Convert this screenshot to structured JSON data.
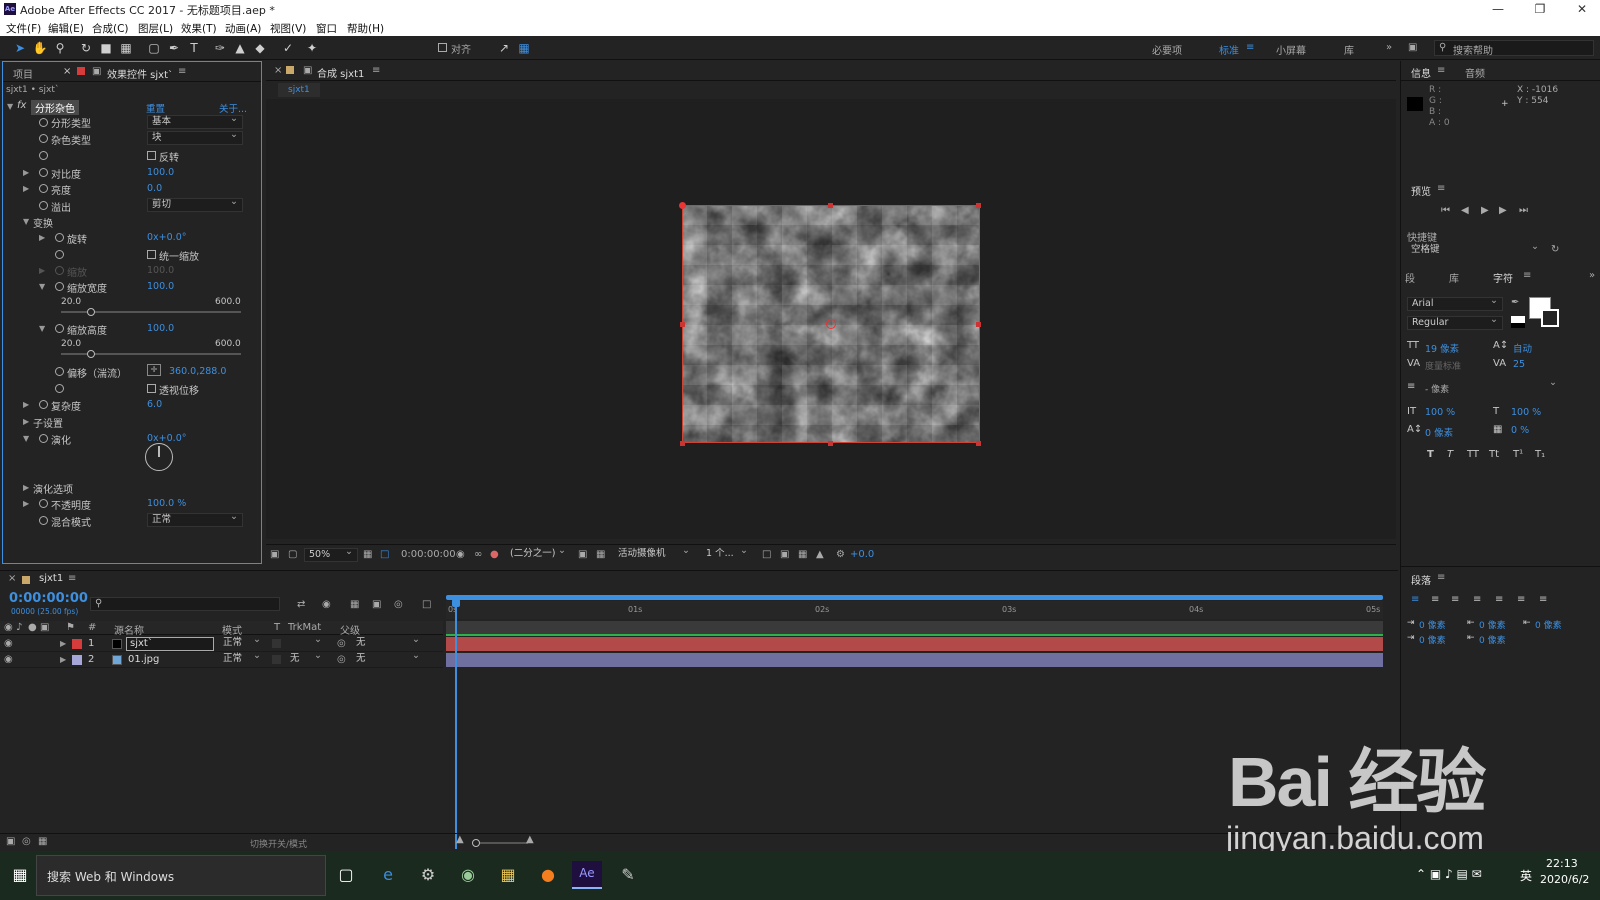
{
  "app": {
    "title": "Adobe After Effects CC 2017 - 无标题项目.aep *",
    "logo": "Ae"
  },
  "menu": [
    "文件(F)",
    "编辑(E)",
    "合成(C)",
    "图层(L)",
    "效果(T)",
    "动画(A)",
    "视图(V)",
    "窗口",
    "帮助(H)"
  ],
  "toolbar": {
    "snap_label": "对齐",
    "workspaces": [
      "必要项",
      "标准",
      "小屏幕",
      "库"
    ],
    "search_placeholder": "搜索帮助"
  },
  "project_tab": "项目",
  "effects_panel": {
    "tab": "效果控件 sjxt`",
    "layer_path": "sjxt1 • sjxt`",
    "effect_name": "分形杂色",
    "reset": "重置",
    "about": "关于...",
    "rows": [
      {
        "label": "分形类型",
        "value": "基本"
      },
      {
        "label": "杂色类型",
        "value": "块"
      },
      {
        "label": "",
        "value": "反转"
      },
      {
        "label": "对比度",
        "value": "100.0"
      },
      {
        "label": "亮度",
        "value": "0.0"
      },
      {
        "label": "溢出",
        "value": "剪切"
      },
      {
        "label": "变换",
        "value": ""
      },
      {
        "label": "旋转",
        "value": "0x+0.0°"
      },
      {
        "label": "",
        "value": "统一缩放"
      },
      {
        "label": "缩放",
        "value": "100.0"
      },
      {
        "label": "缩放宽度",
        "value": "100.0"
      },
      {
        "label": "缩放高度",
        "value": "100.0"
      },
      {
        "label": "偏移（湍流）",
        "value": "360.0,288.0"
      },
      {
        "label": "",
        "value": "透视位移"
      },
      {
        "label": "复杂度",
        "value": "6.0"
      },
      {
        "label": "子设置",
        "value": ""
      },
      {
        "label": "演化",
        "value": "0x+0.0°"
      },
      {
        "label": "演化选项",
        "value": ""
      },
      {
        "label": "不透明度",
        "value": "100.0 %"
      },
      {
        "label": "混合模式",
        "value": "正常"
      }
    ],
    "slider_min": "20.0",
    "slider_max": "600.0"
  },
  "comp_panel": {
    "tab": "合成 sjxt1",
    "subtab": "sjxt1",
    "zoom": "50%",
    "time": "0:00:00:00",
    "resolution": "(二分之一)",
    "camera": "活动摄像机",
    "views": "1 个...",
    "exposure": "+0.0"
  },
  "info": {
    "tab1": "信息",
    "tab2": "音频",
    "rgba": [
      "R :",
      "G :",
      "B :",
      "A : 0"
    ],
    "x": "X : -1016",
    "y": "Y : 554"
  },
  "preview": {
    "tab": "预览",
    "shortcut_label": "快捷键",
    "shortcut_value": "空格键"
  },
  "character": {
    "tabs": [
      "段",
      "库",
      "字符"
    ],
    "font": "Arial",
    "style": "Regular",
    "size": "19 像素",
    "leading": "自动",
    "kerning": "度量标准",
    "tracking": "25",
    "stroke": "- 像素",
    "vscale": "100 %",
    "hscale": "100 %",
    "baseline": "0 像素",
    "tsume": "0 %"
  },
  "paragraph": {
    "tab": "段落",
    "indents": [
      "0 像素",
      "0 像素",
      "0 像素",
      "0 像素",
      "0 像素"
    ]
  },
  "timeline": {
    "tab": "sjxt1",
    "timecode": "0:00:00:00",
    "fps": "00000 (25.00 fps)",
    "headers": [
      "#",
      "源名称",
      "模式",
      "T",
      "TrkMat",
      "父级"
    ],
    "layers": [
      {
        "num": "1",
        "name": "sjxt`",
        "mode": "正常",
        "trkmat": "",
        "parent": "无",
        "color": "#d63c3c"
      },
      {
        "num": "2",
        "name": "01.jpg",
        "mode": "正常",
        "trkmat": "无",
        "parent": "无",
        "color": "#a6a6d8"
      }
    ],
    "ruler": [
      "0s",
      "01s",
      "02s",
      "03s",
      "04s",
      "05s"
    ],
    "footer": "切换开关/模式"
  },
  "taskbar": {
    "search": "搜索 Web 和 Windows",
    "time": "22:13",
    "date": "2020/6/2",
    "lang": "英"
  },
  "watermark": {
    "brand": "Bai 经验",
    "url": "jingyan.baidu.com"
  }
}
